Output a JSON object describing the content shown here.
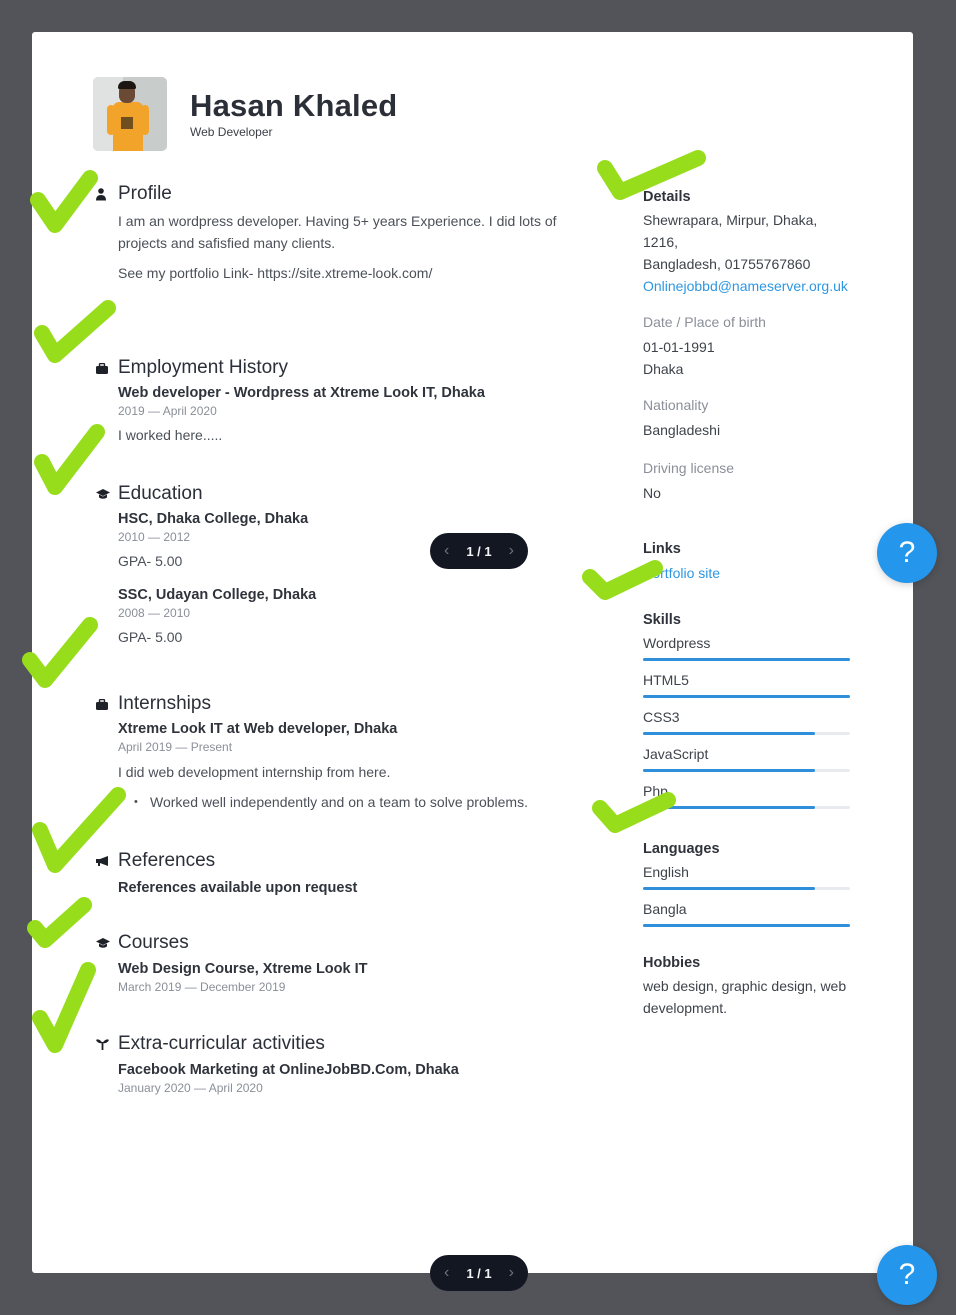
{
  "header": {
    "name": "Hasan Khaled",
    "job_title": "Web Developer"
  },
  "profile": {
    "title": "Profile",
    "icon": "person-icon",
    "paragraphs": [
      "I am an wordpress developer. Having 5+ years Experience. I did lots of projects and safisfied many clients.",
      "See my portfolio Link- https://site.xtreme-look.com/"
    ]
  },
  "employment": {
    "title": "Employment History",
    "icon": "briefcase-icon",
    "items": [
      {
        "title": "Web developer - Wordpress at  Xtreme Look IT, Dhaka",
        "date": "2019 — April 2020",
        "description": "I worked here....."
      }
    ]
  },
  "education": {
    "title": "Education",
    "icon": "graduation-cap-icon",
    "items": [
      {
        "title": "HSC, Dhaka College, Dhaka",
        "date": "2010 — 2012",
        "description": "GPA- 5.00"
      },
      {
        "title": "SSC, Udayan College, Dhaka",
        "date": "2008 — 2010",
        "description": "GPA- 5.00"
      }
    ]
  },
  "internships": {
    "title": "Internships",
    "icon": "briefcase-icon",
    "items": [
      {
        "title": "Xtreme Look IT at  Web developer, Dhaka",
        "date": "April 2019 — Present",
        "description": "I did web development internship from here.",
        "bullets": [
          "Worked well independently and on a team to solve problems."
        ]
      }
    ]
  },
  "references": {
    "title": "References",
    "icon": "megaphone-icon",
    "text": "References available upon request"
  },
  "courses": {
    "title": "Courses",
    "icon": "graduation-cap-icon",
    "items": [
      {
        "title": "Web Design Course, Xtreme Look IT",
        "date": "March 2019 — December 2019"
      }
    ]
  },
  "extracurricular": {
    "title": "Extra-curricular activities",
    "icon": "sprout-icon",
    "items": [
      {
        "title": "Facebook Marketing at  OnlineJobBD.Com, Dhaka",
        "date": "January 2020 — April 2020"
      }
    ]
  },
  "details": {
    "title": "Details",
    "address_line1": "Shewrapara, Mirpur, Dhaka, 1216,",
    "address_line2": "Bangladesh, 01755767860",
    "email": "Onlinejobbd@nameserver.org.uk",
    "birth_label": "Date / Place of birth",
    "birth_date": "01-01-1991",
    "birth_place": "Dhaka",
    "nationality_label": "Nationality",
    "nationality": "Bangladeshi",
    "license_label": "Driving license",
    "license": "No"
  },
  "links": {
    "title": "Links",
    "items": [
      {
        "label": "Portfolio site"
      }
    ]
  },
  "skills": {
    "title": "Skills",
    "items": [
      {
        "label": "Wordpress",
        "level": 100
      },
      {
        "label": "HTML5",
        "level": 100
      },
      {
        "label": "CSS3",
        "level": 83
      },
      {
        "label": "JavaScript",
        "level": 83
      },
      {
        "label": "Php",
        "level": 83
      }
    ]
  },
  "languages": {
    "title": "Languages",
    "items": [
      {
        "label": "English",
        "level": 83
      },
      {
        "label": "Bangla",
        "level": 100
      }
    ]
  },
  "hobbies": {
    "title": "Hobbies",
    "text": "web design, graphic design, web development."
  },
  "pager": {
    "label": "1 / 1",
    "prev_icon": "chevron-left-icon",
    "next_icon": "chevron-right-icon"
  },
  "help": {
    "label": "?"
  },
  "colors": {
    "background": "#525459",
    "accent": "#2f8fda",
    "link": "#2e97e2",
    "help_button": "#2496ec",
    "check_marks": "#97dd1c"
  }
}
